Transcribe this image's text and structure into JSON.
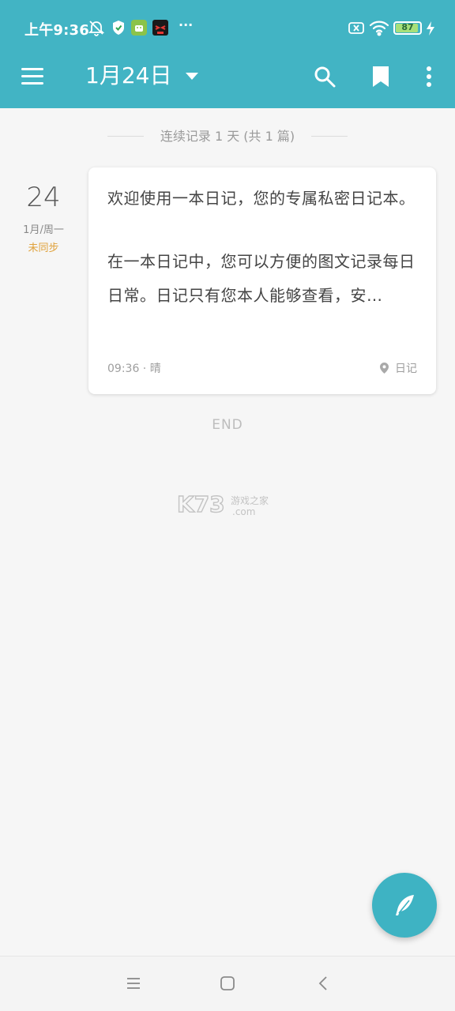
{
  "status_bar": {
    "time": "上午9:36",
    "more": "···",
    "battery_level": "87",
    "battery_fraction": 0.87,
    "icons": [
      "alarm-off-icon",
      "shield-icon",
      "android-icon",
      "app-icon",
      "sim-off-icon",
      "wifi-icon",
      "battery-icon",
      "charging-icon"
    ]
  },
  "toolbar": {
    "title": "1月24日",
    "icons": [
      "menu-icon",
      "search-icon",
      "bookmark-icon",
      "more-vert-icon"
    ]
  },
  "streak": "连续记录 1 天 (共 1 篇)",
  "entry": {
    "day": "24",
    "month_weekday": "1月/周一",
    "sync_status": "未同步",
    "paragraph1": "欢迎使用一本日记，您的专属私密日记本。",
    "paragraph2": "在一本日记中，您可以方便的图文记录每日日常。日记只有您本人能够查看，安…",
    "meta": "09:36 · 晴",
    "tag": "日记"
  },
  "end_label": "END",
  "watermark": {
    "brand": "K73",
    "line1": "游戏之家",
    "line2": ".com"
  },
  "colors": {
    "accent": "#42b4c4",
    "sync_warning": "#e0a23c",
    "background": "#f6f6f6"
  }
}
